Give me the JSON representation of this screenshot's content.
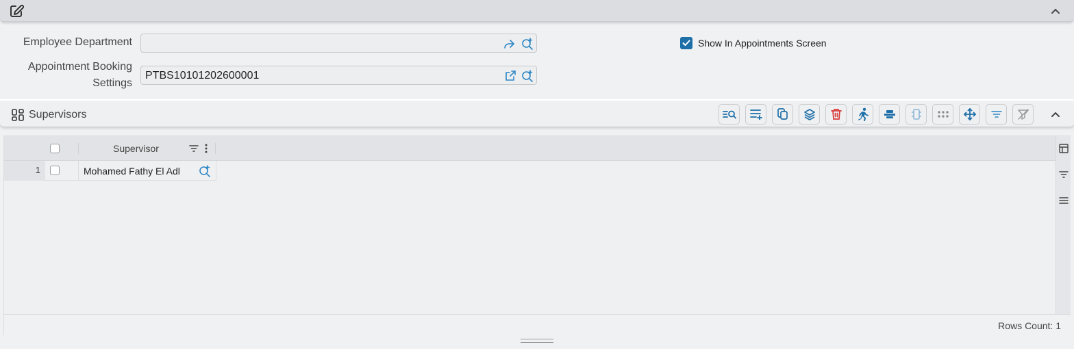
{
  "header": {
    "edit_icon": "edit-icon",
    "collapse_icon": "chevron-up-icon"
  },
  "form": {
    "employee_department": {
      "label": "Employee Department",
      "value": "",
      "icons": [
        "share-arrow-icon",
        "search-plus-icon"
      ]
    },
    "appointment_booking_settings": {
      "label_line1": "Appointment Booking",
      "label_line2": "Settings",
      "value": "PTBS10101202600001",
      "icons": [
        "open-external-icon",
        "search-plus-icon"
      ]
    },
    "show_in_appointments": {
      "label": "Show In Appointments Screen",
      "checked": true
    }
  },
  "supervisors": {
    "title": "Supervisors",
    "toolbar": [
      "search-list-icon",
      "add-row-icon",
      "copy-icon",
      "layers-icon",
      "delete-icon",
      "run-icon",
      "stack-icon",
      "code-icon",
      "dots-grid-icon",
      "move-icon",
      "filter-lines-icon",
      "clear-filter-icon"
    ],
    "grid": {
      "columns": [
        "Supervisor"
      ],
      "rows": [
        {
          "num": "1",
          "supervisor": "Mohamed Fathy El Adl"
        }
      ],
      "footer": "Rows Count: 1"
    }
  },
  "colors": {
    "accent": "#1e6fa8",
    "delete": "#d93a3a",
    "background": "#f0f1f3"
  }
}
